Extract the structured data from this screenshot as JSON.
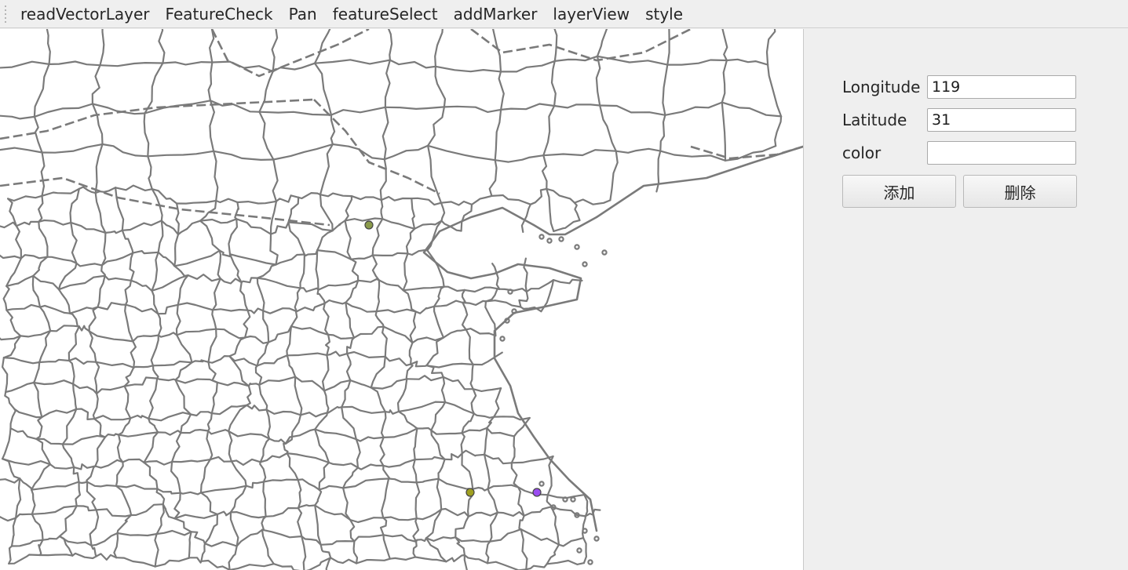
{
  "toolbar": {
    "items": [
      "readVectorLayer",
      "FeatureCheck",
      "Pan",
      "featureSelect",
      "addMarker",
      "layerView",
      "style"
    ]
  },
  "form": {
    "longitude_label": "Longitude",
    "longitude_value": "119",
    "latitude_label": "Latitude",
    "latitude_value": "31",
    "color_label": "color",
    "color_value": "",
    "add_button": "添加",
    "delete_button": "删除"
  },
  "map": {
    "boundary_color": "#7a7a7a",
    "background": "#ffffff",
    "markers": [
      {
        "name": "marker-beijing",
        "color": "#8a9a4a"
      },
      {
        "name": "marker-olive",
        "color": "#a0a020"
      },
      {
        "name": "marker-purple",
        "color": "#9a4cf0"
      }
    ]
  }
}
